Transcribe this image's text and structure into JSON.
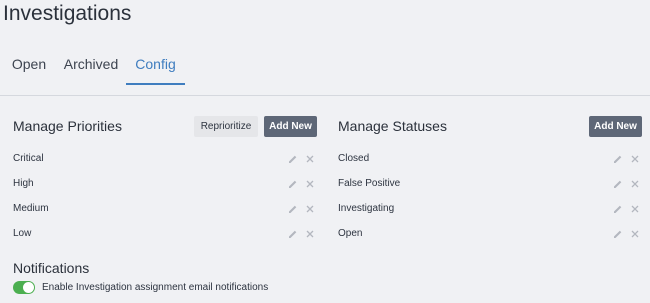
{
  "page": {
    "title": "Investigations"
  },
  "tabs": [
    {
      "label": "Open"
    },
    {
      "label": "Archived"
    },
    {
      "label": "Config",
      "active": true
    }
  ],
  "priorities": {
    "title": "Manage Priorities",
    "reprioritize_label": "Reprioritize",
    "add_label": "Add New",
    "items": [
      {
        "label": "Critical"
      },
      {
        "label": "High"
      },
      {
        "label": "Medium"
      },
      {
        "label": "Low"
      }
    ]
  },
  "statuses": {
    "title": "Manage Statuses",
    "add_label": "Add New",
    "items": [
      {
        "label": "Closed"
      },
      {
        "label": "False Positive"
      },
      {
        "label": "Investigating"
      },
      {
        "label": "Open"
      }
    ]
  },
  "notifications": {
    "title": "Notifications",
    "toggle_label": "Enable Investigation assignment email notifications",
    "enabled": true
  },
  "colors": {
    "accent": "#3f7dbf",
    "dark_button": "#5e6777",
    "toggle_on": "#4caf50",
    "background": "#f0f1f4"
  }
}
